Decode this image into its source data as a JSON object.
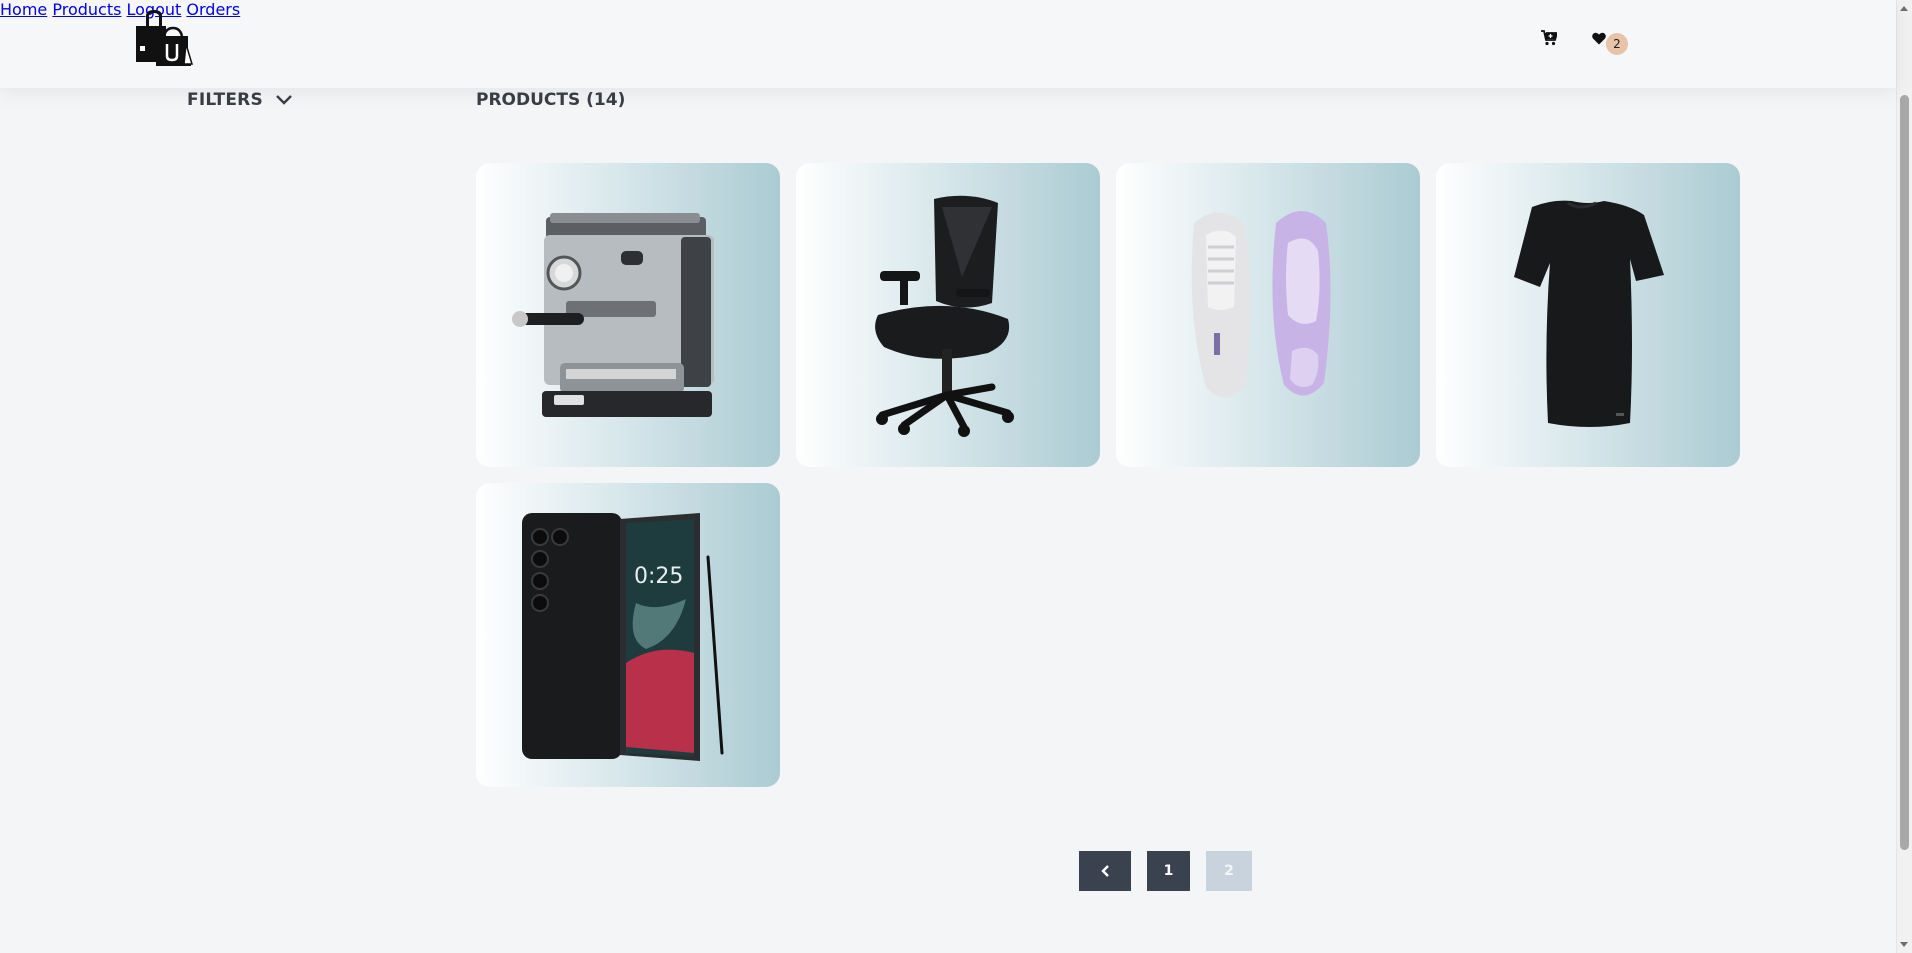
{
  "header": {
    "logo_icon": "shopping-bags-logo",
    "nav": [
      {
        "label": "Home"
      },
      {
        "label": "Products"
      },
      {
        "label": "Logout"
      },
      {
        "label": "Orders"
      }
    ],
    "cart_icon": "cart-icon",
    "wishlist_icon": "heart-icon",
    "wishlist_count": "2"
  },
  "sidebar": {
    "filters_label": "FILTERS",
    "toggle_icon": "chevron-down-icon"
  },
  "main": {
    "title": "PRODUCTS (14)",
    "products": [
      {
        "image": "espresso-machine"
      },
      {
        "image": "office-chair"
      },
      {
        "image": "sneakers"
      },
      {
        "image": "black-t-shirt"
      },
      {
        "image": "smartphone"
      }
    ]
  },
  "pagination": {
    "prev_icon": "chevron-left-icon",
    "pages": [
      "1",
      "2"
    ],
    "current": "1"
  },
  "colors": {
    "page_bg": "#f4f5f7",
    "dark_button": "#3a4250",
    "disabled_button": "#c9d3de",
    "badge": "#e8c3aa"
  }
}
